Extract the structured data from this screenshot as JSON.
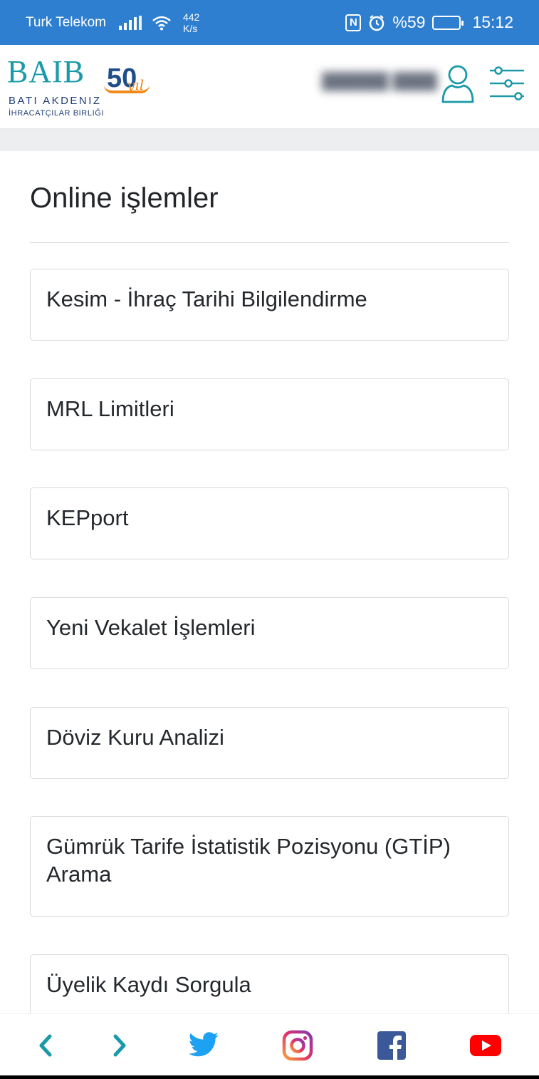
{
  "status_bar": {
    "carrier": "Turk Telekom",
    "net_speed_value": "442",
    "net_speed_unit": "K/s",
    "battery_text": "%59",
    "battery_level": 0.59,
    "time": "15:12"
  },
  "header": {
    "logo_main": "BAIB",
    "logo_anniversary": "50",
    "logo_anniversary_suffix": "yıl",
    "logo_line1": "BATI AKDENIZ",
    "logo_line2": "İHRACATÇILAR BIRLIĞI",
    "accent_color": "#1a9aa8"
  },
  "page": {
    "title": "Online işlemler",
    "items": [
      {
        "label": "Kesim - İhraç Tarihi Bilgilendirme"
      },
      {
        "label": "MRL Limitleri"
      },
      {
        "label": "KEPport"
      },
      {
        "label": "Yeni Vekalet İşlemleri"
      },
      {
        "label": "Döviz Kuru Analizi"
      },
      {
        "label": "Gümrük Tarife İstatistik Pozisyonu (GTİP) Arama"
      },
      {
        "label": "Üyelik Kaydı Sorgula"
      }
    ]
  },
  "bottom_nav": {
    "items": [
      {
        "icon": "chevron-left-icon",
        "color": "#1a9aa8"
      },
      {
        "icon": "chevron-right-icon",
        "color": "#1a9aa8"
      },
      {
        "icon": "twitter-icon",
        "color": "#1da1f2"
      },
      {
        "icon": "instagram-icon",
        "color": "#c13584"
      },
      {
        "icon": "facebook-icon",
        "color": "#3b5998"
      },
      {
        "icon": "youtube-icon",
        "color": "#ff0000"
      }
    ]
  }
}
